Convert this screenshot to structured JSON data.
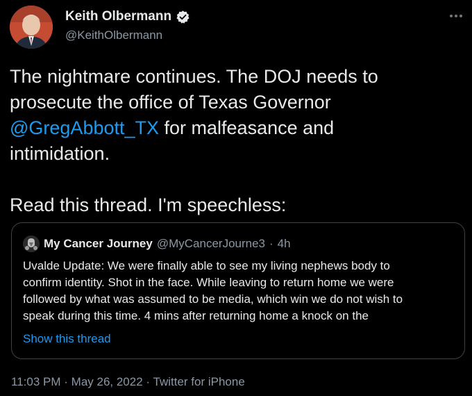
{
  "author": {
    "display_name": "Keith Olbermann",
    "handle": "@KeithOlbermann"
  },
  "tweet": {
    "line1": "The nightmare continues. The DOJ needs to",
    "line2": "prosecute the office of Texas Governor",
    "mention": "@GregAbbott_TX",
    "line3_rest": " for malfeasance and",
    "line4": "intimidation.",
    "line5": "Read this thread. I'm speechless:"
  },
  "quote": {
    "name": "My Cancer Journey",
    "handle": "@MyCancerJourne3",
    "separator": "·",
    "time": "4h",
    "body_lines": [
      "Uvalde Update: We were finally able to see my living nephews body to",
      "confirm identity. Shot in the face. While leaving to return home we were",
      "followed by what was assumed to be media, which win we do not wish to",
      "speak during this time. 4 mins after returning home a knock on the"
    ],
    "show_thread": "Show this thread"
  },
  "meta": {
    "time": "11:03 PM",
    "sep1": "·",
    "date": "May 26, 2022",
    "sep2": "·",
    "source": "Twitter for iPhone"
  },
  "colors": {
    "background": "#000000",
    "text": "#e7e9ea",
    "secondary": "#8b98a5",
    "link": "#1d9bf0",
    "border": "#3e4144"
  },
  "icons": {
    "verified": "verified-badge-icon",
    "more": "more-options-icon"
  }
}
